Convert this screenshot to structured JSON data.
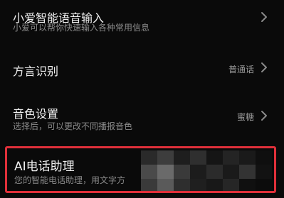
{
  "settings": {
    "items": [
      {
        "title": "小爱智能语音输入",
        "subtitle": "小爱可以帮你快速输入各种常用信息",
        "value": ""
      },
      {
        "title": "方言识别",
        "subtitle": "",
        "value": "普通话"
      },
      {
        "title": "音色设置",
        "subtitle": "选择后，可以更改不同播报音色",
        "value": "蜜糖"
      },
      {
        "title": "AI电话助理",
        "subtitle": "您的智能电话助理，用文字方",
        "value": ""
      }
    ]
  },
  "icons": {
    "chevron": "chevron-right-icon"
  },
  "colors": {
    "background": "#0a0a0a",
    "highlight": "#e0303a",
    "title_text": "#f0f0f0",
    "subtitle_text": "#8a8a8a"
  }
}
